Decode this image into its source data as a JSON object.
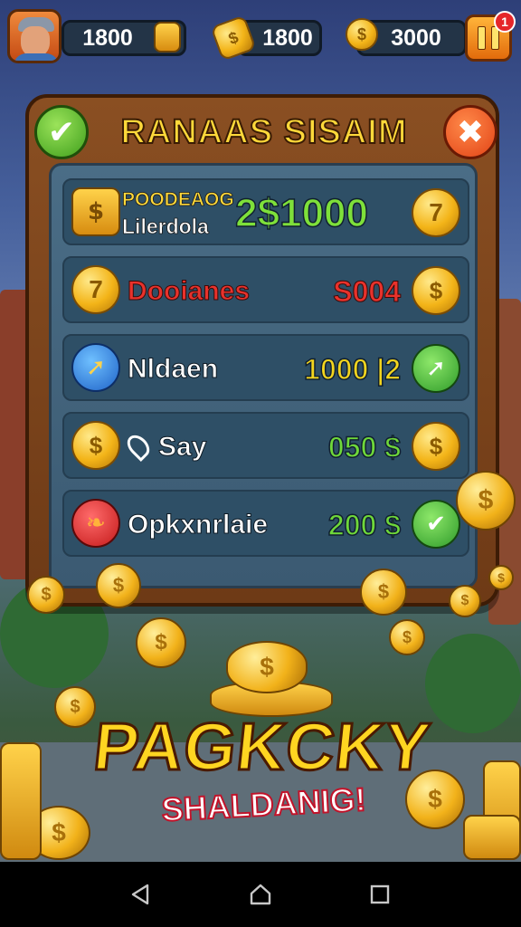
{
  "topbar": {
    "gems_value": "1800",
    "gold_value": "1800",
    "coins_value": "3000",
    "notification_count": "1"
  },
  "panel": {
    "title": "RANAAS SISAIM",
    "rows": [
      {
        "label_top": "POODEAOG",
        "label_bottom": "Lilerdola",
        "value": "2$1000",
        "value_color": "#7ee03a"
      },
      {
        "label": "Dooianes",
        "value": "S004",
        "value_color": "#e8322c",
        "label_color": "#e8322c"
      },
      {
        "label": "Nldaen",
        "value": "1000 |2",
        "value_color": "#f3d51e"
      },
      {
        "label": "Say",
        "value": "050 $",
        "value_color": "#6fd83a"
      },
      {
        "label": "Opkxnrlaie",
        "value": "200 $",
        "value_color": "#6fd83a"
      }
    ]
  },
  "promo": {
    "headline": "PAGKCKY",
    "subline": "SHALDANIG!"
  },
  "icons": {
    "avatar": "player-avatar",
    "pause": "pause-icon",
    "back": "check-icon",
    "close": "close-icon"
  },
  "colors": {
    "title": "#ffd93a",
    "panel_wood": "#7a4219",
    "panel_inner": "#41627b",
    "back_button": "#4fb123",
    "close_button": "#e8521c"
  }
}
